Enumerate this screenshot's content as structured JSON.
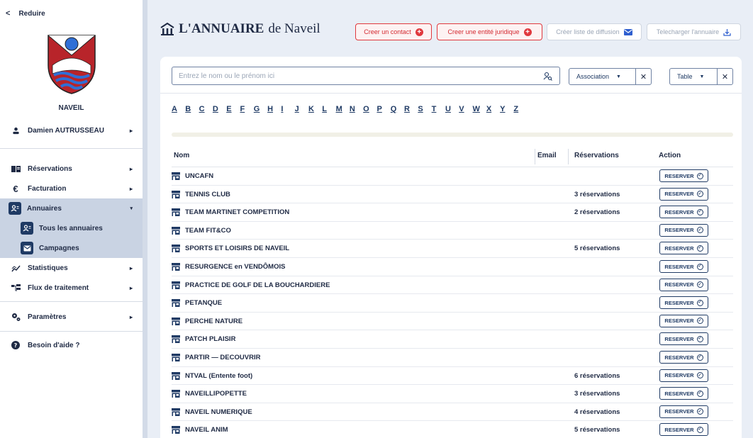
{
  "sidebar": {
    "reduce_label": "Reduire",
    "town": "NAVEIL",
    "user": "Damien AUTRUSSEAU",
    "items": {
      "reservations": "Réservations",
      "facturation": "Facturation",
      "annuaires": "Annuaires",
      "tous_annuaires": "Tous les annuaires",
      "campagnes": "Campagnes",
      "statistiques": "Statistiques",
      "flux": "Flux de traitement",
      "parametres": "Paramètres",
      "aide": "Besoin d'aide ?"
    }
  },
  "header": {
    "brand_bold": "L'ANNUAIRE",
    "brand_rest": "de Naveil",
    "btn_contact": "Creer un contact",
    "btn_entite": "Creer une entité juridique",
    "btn_diffusion": "Créer liste de diffusion",
    "btn_telecharger": "Telecharger l'annuaire"
  },
  "search": {
    "placeholder": "Entrez le nom ou le prénom ici"
  },
  "filters": {
    "type": "Association",
    "view": "Table"
  },
  "letters": [
    "A",
    "B",
    "C",
    "D",
    "E",
    "F",
    "G",
    "H",
    "I",
    "J",
    "K",
    "L",
    "M",
    "N",
    "O",
    "P",
    "Q",
    "R",
    "S",
    "T",
    "U",
    "V",
    "W",
    "X",
    "Y",
    "Z"
  ],
  "table": {
    "headers": {
      "nom": "Nom",
      "email": "Email",
      "reservations": "Réservations",
      "action": "Action"
    },
    "action_label": "RESERVER",
    "rows": [
      {
        "name": "UNCAFN",
        "res": ""
      },
      {
        "name": "TENNIS CLUB",
        "res": "3 réservations"
      },
      {
        "name": "TEAM MARTINET COMPETITION",
        "res": "2 réservations"
      },
      {
        "name": "TEAM FIT&CO",
        "res": ""
      },
      {
        "name": "SPORTS ET LOISIRS DE NAVEIL",
        "res": "5 réservations"
      },
      {
        "name": "RESURGENCE en VENDÔMOIS",
        "res": ""
      },
      {
        "name": "PRACTICE DE GOLF DE LA BOUCHARDIERE",
        "res": ""
      },
      {
        "name": "PETANQUE",
        "res": ""
      },
      {
        "name": "PERCHE NATURE",
        "res": ""
      },
      {
        "name": "PATCH PLAISIR",
        "res": ""
      },
      {
        "name": "PARTIR — DECOUVRIR",
        "res": ""
      },
      {
        "name": "NTVAL (Entente foot)",
        "res": "6 réservations"
      },
      {
        "name": "NAVEILLIPOPETTE",
        "res": "3 réservations"
      },
      {
        "name": "NAVEIL NUMERIQUE",
        "res": "4 réservations"
      },
      {
        "name": "NAVEIL ANIM",
        "res": "5 réservations"
      }
    ]
  },
  "colors": {
    "accent": "#1f3a64",
    "danger": "#e0393e",
    "sidebar_active": "#c9d3e3"
  },
  "icons": [
    "chevron-left-icon",
    "person-icon",
    "book-icon",
    "euro-icon",
    "contacts-icon",
    "mail-icon",
    "chart-icon",
    "flow-icon",
    "gears-icon",
    "help-icon",
    "search-person-icon",
    "shop-icon",
    "check-circle-icon",
    "download-icon",
    "plus-circle-icon",
    "close-icon",
    "caret-down-icon"
  ]
}
